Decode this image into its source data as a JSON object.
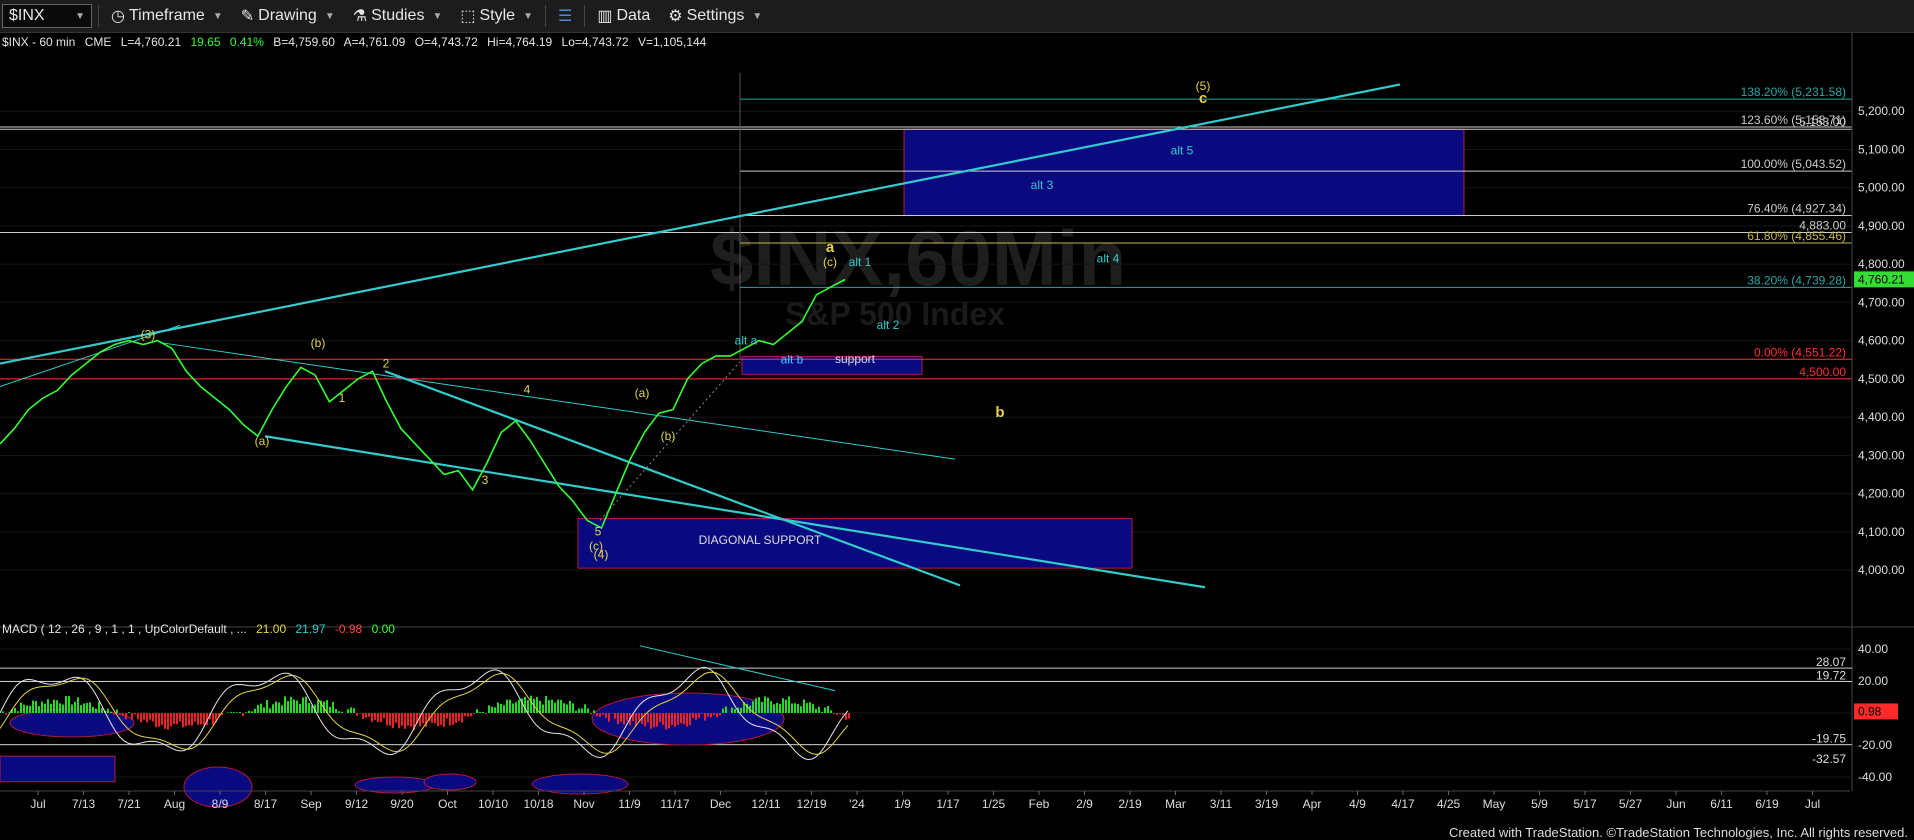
{
  "toolbar": {
    "symbol": "$INX",
    "buttons": [
      {
        "name": "timeframe-button",
        "icon": "clock-icon",
        "label": "Timeframe"
      },
      {
        "name": "drawing-button",
        "icon": "pencil-icon",
        "label": "Drawing"
      },
      {
        "name": "studies-button",
        "icon": "flask-icon",
        "label": "Studies"
      },
      {
        "name": "style-button",
        "icon": "style-icon",
        "label": "Style"
      },
      {
        "name": "layout-button",
        "icon": "layout-icon",
        "label": ""
      },
      {
        "name": "data-button",
        "icon": "bar-chart-icon",
        "label": "Data"
      },
      {
        "name": "settings-button",
        "icon": "gear-icon",
        "label": "Settings"
      }
    ]
  },
  "header": {
    "symbol_line": "$INX - 60 min",
    "exchange": "CME",
    "last": "L=4,760.21",
    "change": "19.65",
    "pct": "0.41%",
    "bid": "B=4,759.60",
    "ask": "A=4,761.09",
    "open": "O=4,743.72",
    "high": "Hi=4,764.19",
    "low": "Lo=4,743.72",
    "volume": "V=1,105,144"
  },
  "watermark": {
    "main": "$INX,60Min",
    "sub": "S&P 500 Index"
  },
  "macd_header": {
    "label": "MACD ( 12 , 26 , 9 , 1 , 1 , UpColorDefault , ...",
    "v1": "21.00",
    "v2": "21.97",
    "v3": "-0.98",
    "v4": "0.00"
  },
  "colors": {
    "price": "#33ff33",
    "cyan": "#33cccc",
    "yellow": "#e6d34a",
    "navy": "#0a0a80",
    "red": "#ff2a2a",
    "macd_hist_up": "#22dd22",
    "macd_hist_down": "#ee2222"
  },
  "chart_data": {
    "type": "line",
    "title": "$INX,60Min",
    "subtitle": "S&P 500 Index",
    "price_axis": {
      "ticks": [
        "5,200.00",
        "5,100.00",
        "5,000.00",
        "4,900.00",
        "4,800.00",
        "4,700.00",
        "4,600.00",
        "4,500.00",
        "4,400.00",
        "4,300.00",
        "4,200.00",
        "4,100.00",
        "4,000.00"
      ],
      "tick_values": [
        5200,
        5100,
        5000,
        4900,
        4800,
        4700,
        4600,
        4500,
        4400,
        4300,
        4200,
        4100,
        4000
      ],
      "ylim": [
        3940,
        5300
      ]
    },
    "time_axis": [
      "Jul",
      "7/13",
      "7/21",
      "Aug",
      "8/9",
      "8/17",
      "Sep",
      "9/12",
      "9/20",
      "Oct",
      "10/10",
      "10/18",
      "Nov",
      "11/9",
      "11/17",
      "Dec",
      "12/11",
      "12/19",
      "'24",
      "1/9",
      "1/17",
      "1/25",
      "Feb",
      "2/9",
      "2/19",
      "Mar",
      "3/11",
      "3/19",
      "Apr",
      "4/9",
      "4/17",
      "4/25",
      "May",
      "5/9",
      "5/17",
      "5/27",
      "Jun",
      "6/11",
      "6/19",
      "Jul"
    ],
    "last_price": "4,760.21",
    "series": [
      {
        "name": "$INX - 60 min",
        "points": [
          [
            0,
            4330
          ],
          [
            1,
            4370
          ],
          [
            2,
            4420
          ],
          [
            3,
            4450
          ],
          [
            4,
            4470
          ],
          [
            5,
            4510
          ],
          [
            6,
            4540
          ],
          [
            7,
            4570
          ],
          [
            8,
            4590
          ],
          [
            9,
            4600
          ],
          [
            10,
            4590
          ],
          [
            11,
            4600
          ],
          [
            12,
            4580
          ],
          [
            13,
            4520
          ],
          [
            14,
            4480
          ],
          [
            15,
            4450
          ],
          [
            16,
            4420
          ],
          [
            17,
            4380
          ],
          [
            18,
            4350
          ],
          [
            19,
            4420
          ],
          [
            20,
            4480
          ],
          [
            21,
            4530
          ],
          [
            22,
            4510
          ],
          [
            23,
            4440
          ],
          [
            24,
            4470
          ],
          [
            25,
            4500
          ],
          [
            26,
            4520
          ],
          [
            27,
            4440
          ],
          [
            28,
            4370
          ],
          [
            29,
            4330
          ],
          [
            30,
            4290
          ],
          [
            31,
            4250
          ],
          [
            32,
            4260
          ],
          [
            33,
            4210
          ],
          [
            34,
            4280
          ],
          [
            35,
            4360
          ],
          [
            36,
            4390
          ],
          [
            37,
            4340
          ],
          [
            38,
            4280
          ],
          [
            39,
            4220
          ],
          [
            40,
            4180
          ],
          [
            41,
            4130
          ],
          [
            42,
            4110
          ],
          [
            43,
            4200
          ],
          [
            44,
            4290
          ],
          [
            45,
            4360
          ],
          [
            46,
            4410
          ],
          [
            47,
            4420
          ],
          [
            48,
            4500
          ],
          [
            49,
            4540
          ],
          [
            50,
            4560
          ],
          [
            51,
            4560
          ],
          [
            52,
            4580
          ],
          [
            53,
            4600
          ],
          [
            54,
            4590
          ],
          [
            55,
            4620
          ],
          [
            56,
            4650
          ],
          [
            57,
            4720
          ],
          [
            58,
            4740
          ],
          [
            59,
            4760
          ]
        ]
      }
    ],
    "horizontal_levels": [
      {
        "label": "138.20% (5,231.58)",
        "value": 5231.58
      },
      {
        "label": "123.60% (5,158.71)",
        "value": 5158.71
      },
      {
        "label": "5,153.00",
        "value": 5153
      },
      {
        "label": "100.00% (5,043.52)",
        "value": 5043.52
      },
      {
        "label": "76.40% (4,927.34)",
        "value": 4927.34
      },
      {
        "label": "4,883.00",
        "value": 4883
      },
      {
        "label": "61.80% (4,855.46)",
        "value": 4855.46
      },
      {
        "label": "38.20% (4,739.28)",
        "value": 4739.28
      },
      {
        "label": "0.00% (4,551.22)",
        "value": 4551.22
      },
      {
        "label": "4,500.00",
        "value": 4500
      }
    ],
    "wave_labels": {
      "yellow": [
        "(3)",
        "(b)",
        "2",
        "(a)",
        "1",
        "3",
        "4",
        "(a)",
        "(b)",
        "5",
        "(c)",
        "(4)",
        "a",
        "(c)",
        "(5)",
        "c",
        "b"
      ],
      "cyan": [
        "alt a",
        "alt b",
        "support",
        "alt 1",
        "alt 2",
        "alt 3",
        "alt 4",
        "alt 5"
      ]
    },
    "boxes": [
      "alt 3 / alt 5 target zone",
      "support",
      "DIAGONAL SUPPORT"
    ],
    "macd_axis": {
      "ticks": [
        "40.00",
        "20.00",
        "0.00",
        "-20.00",
        "-40.00"
      ],
      "tick_values": [
        40,
        20,
        0,
        -20,
        -40
      ],
      "levels": [
        "28.07",
        "19.72",
        "0.98",
        "-19.75",
        "-32.57"
      ],
      "ylim": [
        -45,
        45
      ]
    }
  },
  "footer": {
    "credit": "Created with TradeStation. ©TradeStation Technologies, Inc. All rights reserved."
  }
}
